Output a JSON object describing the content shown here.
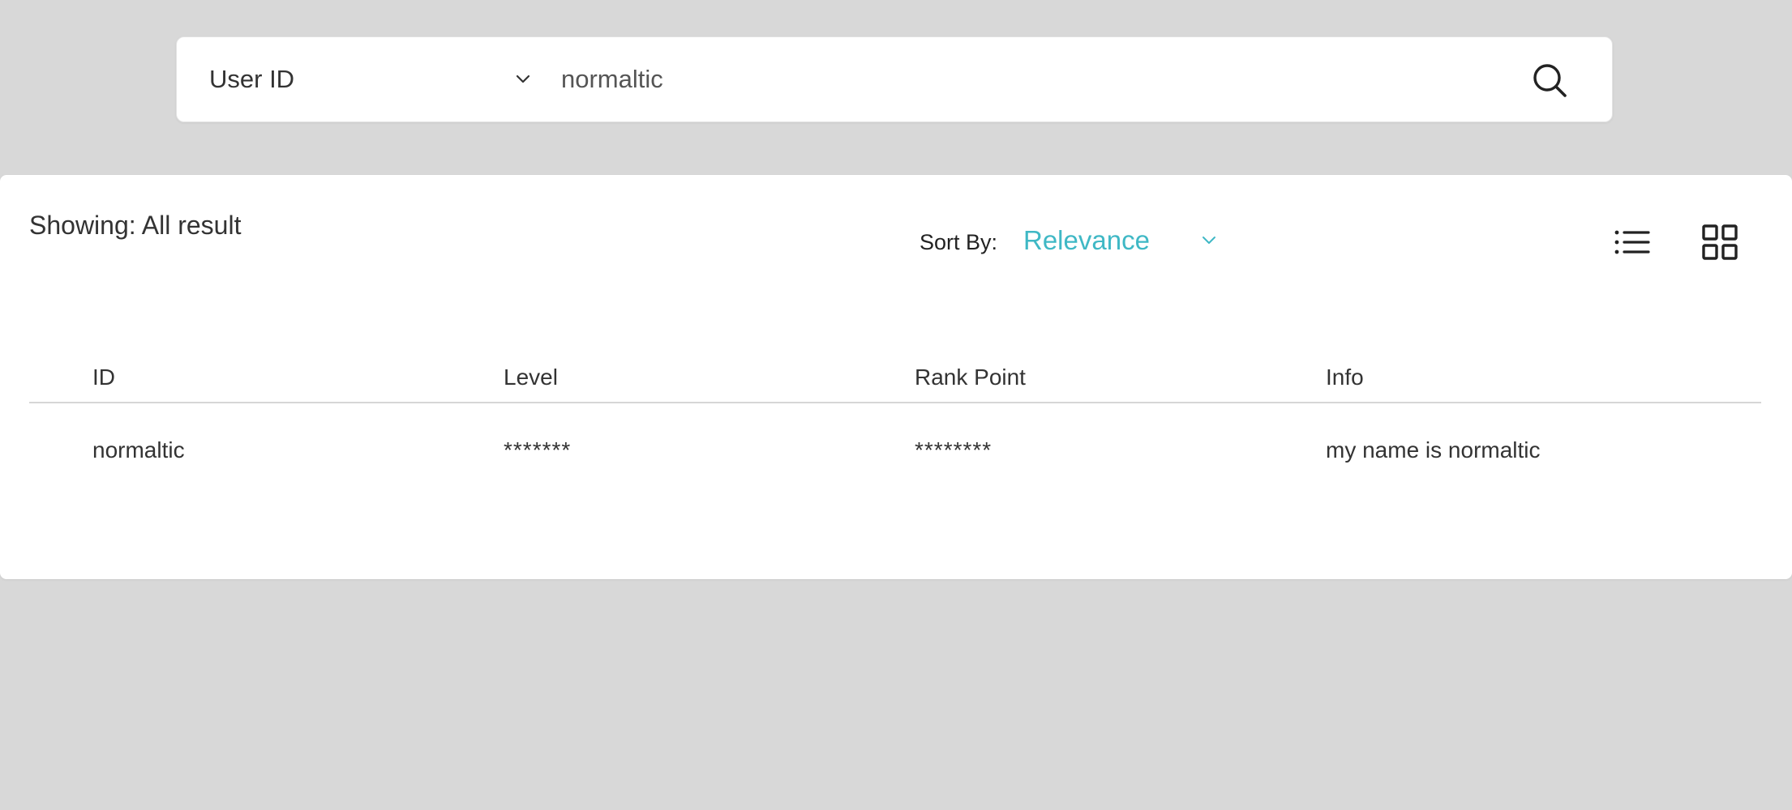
{
  "search": {
    "type_label": "User ID",
    "query": "normaltic"
  },
  "results": {
    "showing_label": "Showing: All result",
    "sort_label": "Sort By:",
    "sort_value": "Relevance",
    "accent_color": "#3fb8c5",
    "view_icons": [
      "list-view-icon",
      "grid-view-icon"
    ],
    "columns": [
      "ID",
      "Level",
      "Rank Point",
      "Info"
    ],
    "rows": [
      [
        "normaltic",
        "*******",
        "********",
        "my name is normaltic"
      ]
    ]
  }
}
